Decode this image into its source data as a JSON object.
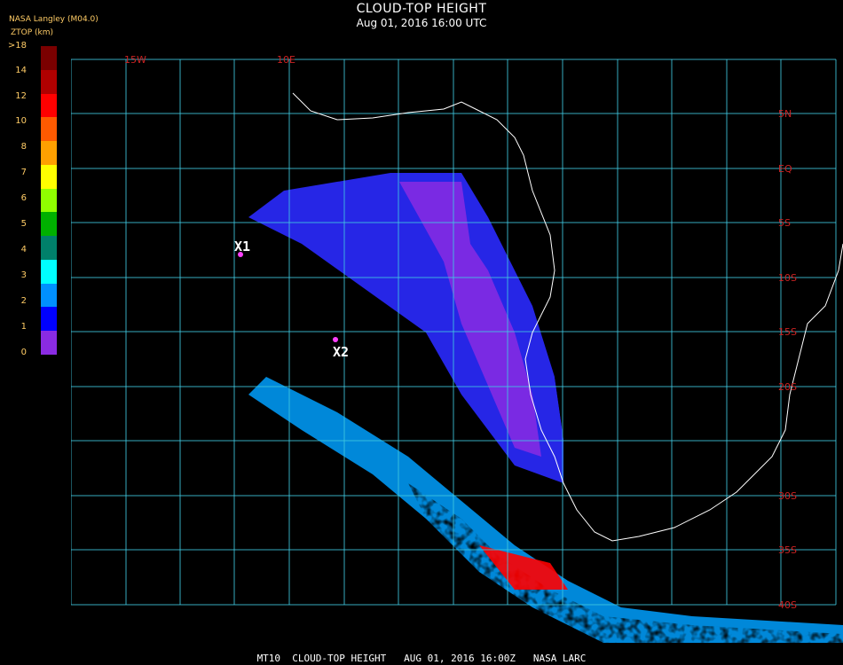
{
  "header": {
    "title": "CLOUD-TOP HEIGHT",
    "datetime": "Aug 01, 2016 16:00 UTC",
    "credit": "NASA Langley (M04.0)",
    "units": "ZTOP (km)"
  },
  "colorbar": {
    "labels": [
      ">18",
      "14",
      "12",
      "10",
      "8",
      "7",
      "6",
      "5",
      "4",
      "3",
      "2",
      "1",
      "0"
    ],
    "colors": [
      "#7a0000",
      "#b00000",
      "#ff0000",
      "#ff5a00",
      "#ffa000",
      "#ffff00",
      "#90ff00",
      "#00b000",
      "#00806a",
      "#00ffff",
      "#0090ff",
      "#0000ff",
      "#8a2be2"
    ]
  },
  "map": {
    "lat_labels": [
      "5N",
      "EQ",
      "5S",
      "10S",
      "15S",
      "20S",
      "30S",
      "35S",
      "40S"
    ],
    "lon_labels": [
      "15W",
      "10E"
    ],
    "markers": [
      {
        "id": "X1",
        "label": "X1"
      },
      {
        "id": "X2",
        "label": "X2"
      }
    ],
    "grid_color": "#40c8e0",
    "coast_color": "#ffffff"
  },
  "footer": {
    "text": "MT10  CLOUD-TOP HEIGHT   AUG 01, 2016 16:00Z   NASA LARC"
  }
}
